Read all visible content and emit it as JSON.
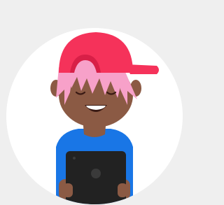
{
  "avatar": {
    "icon": "person-with-tablet-avatar-icon",
    "accessory_icons": [
      "backwards-cap-icon",
      "tablet-icon"
    ],
    "colors": {
      "page_background": "#efefef",
      "circle": "#ffffff",
      "cap": "#f5325a",
      "cap_shadow": "#d81f47",
      "hair": "#f7a1c9",
      "skin": "#8b5a44",
      "shirt": "#1976e6",
      "tablet": "#222222",
      "tablet_button": "#3a3a3a",
      "mouth": "#3a1a14",
      "teeth": "#ffffff"
    }
  }
}
